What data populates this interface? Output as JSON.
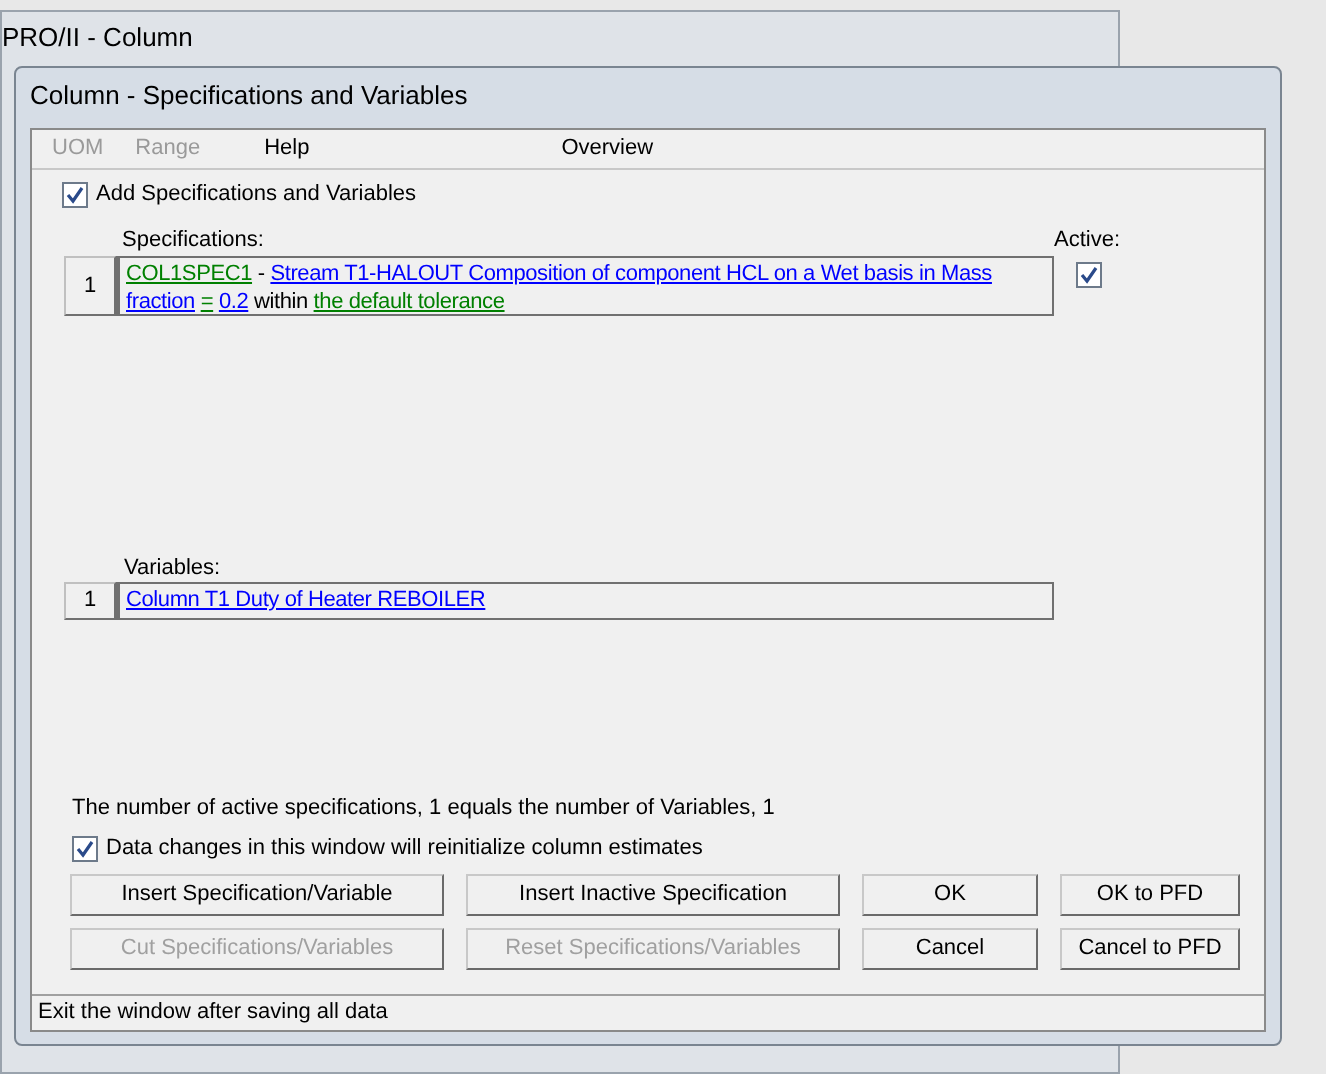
{
  "background_window": {
    "title": "PRO/II - Column"
  },
  "dialog": {
    "title": "Column - Specifications and Variables"
  },
  "menu": [
    {
      "label": "UOM",
      "disabled": true
    },
    {
      "label": "Range",
      "disabled": true
    },
    {
      "label": "Help",
      "disabled": false
    },
    {
      "label": "Overview",
      "disabled": false
    }
  ],
  "add_checkbox": {
    "label": "Add Specifications and Variables",
    "checked": true
  },
  "specifications": {
    "label": "Specifications:",
    "active_label": "Active:",
    "rows": [
      {
        "number": "1",
        "active": true,
        "segments": [
          {
            "kind": "link",
            "text": "COL1SPEC1",
            "color": "#008000"
          },
          {
            "kind": "text",
            "text": "-"
          },
          {
            "kind": "link",
            "text": "Stream T1-HALOUT Composition of component HCL on a Wet basis in Mass",
            "color": "#0000ff"
          },
          {
            "kind": "link",
            "text": "fraction",
            "color": "#0000ff"
          },
          {
            "kind": "link",
            "text": "=",
            "color": "#008000"
          },
          {
            "kind": "link",
            "text": "0.2",
            "color": "#0000ff"
          },
          {
            "kind": "text",
            "text": "within"
          },
          {
            "kind": "link",
            "text": "the default tolerance",
            "color": "#008000"
          }
        ]
      }
    ]
  },
  "variables": {
    "label": "Variables:",
    "rows": [
      {
        "number": "1",
        "segments": [
          {
            "kind": "link",
            "text": "Column T1 Duty of Heater REBOILER",
            "color": "#0000ff"
          }
        ]
      }
    ]
  },
  "summary": "The number of active specifications, 1 equals the number of Variables, 1",
  "reinit_checkbox": {
    "label": "Data changes in this window will reinitialize column estimates",
    "checked": true
  },
  "buttons": [
    {
      "label": "Insert Specification/Variable",
      "disabled": false
    },
    {
      "label": "Insert Inactive Specification",
      "disabled": false
    },
    {
      "label": "OK",
      "disabled": false
    },
    {
      "label": "OK to PFD",
      "disabled": false
    },
    {
      "label": "Cut Specifications/Variables",
      "disabled": true
    },
    {
      "label": "Reset Specifications/Variables",
      "disabled": true
    },
    {
      "label": "Cancel",
      "disabled": false
    },
    {
      "label": "Cancel to PFD",
      "disabled": false
    }
  ],
  "status_bar": "Exit the window after saving all data"
}
